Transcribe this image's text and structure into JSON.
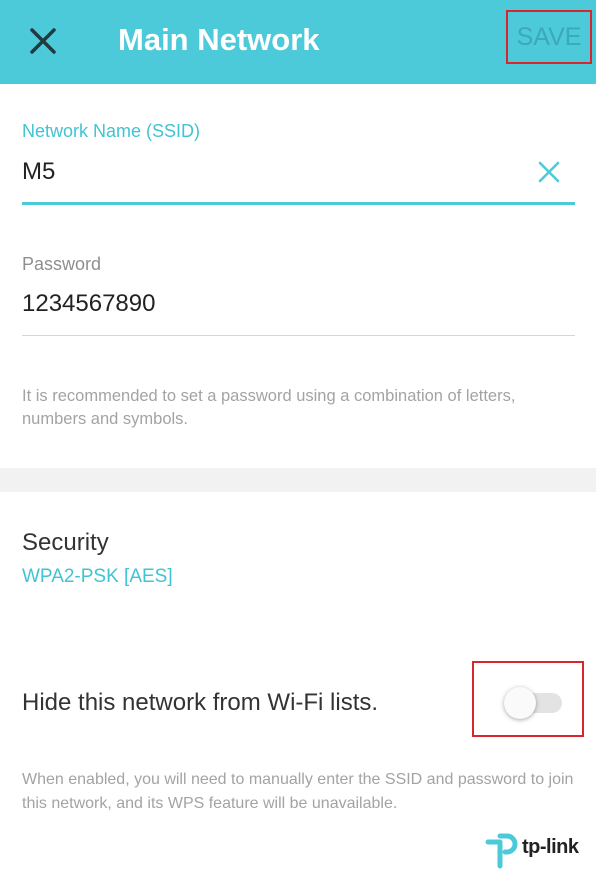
{
  "appbar": {
    "title": "Main Network",
    "save_label": "SAVE",
    "close_icon": "close-icon"
  },
  "ssid": {
    "label": "Network Name (SSID)",
    "value": "M5",
    "clear_icon": "clear-icon"
  },
  "password": {
    "label": "Password",
    "value": "1234567890",
    "hint": "It is recommended to set a password using a combination of letters, numbers and symbols."
  },
  "security": {
    "title": "Security",
    "value": "WPA2-PSK [AES]"
  },
  "hide_network": {
    "label": "Hide this network from Wi-Fi lists.",
    "enabled": false,
    "hint": "When enabled, you will need to manually enter the SSID and password to join this network, and its WPS feature will be unavailable."
  },
  "brand": {
    "logo_text": "tp-link",
    "logo_icon": "tp-link-logo-icon"
  },
  "colors": {
    "appbar": "#4dcad9",
    "accent": "#40c4d3",
    "highlight_border": "#d8262f"
  }
}
